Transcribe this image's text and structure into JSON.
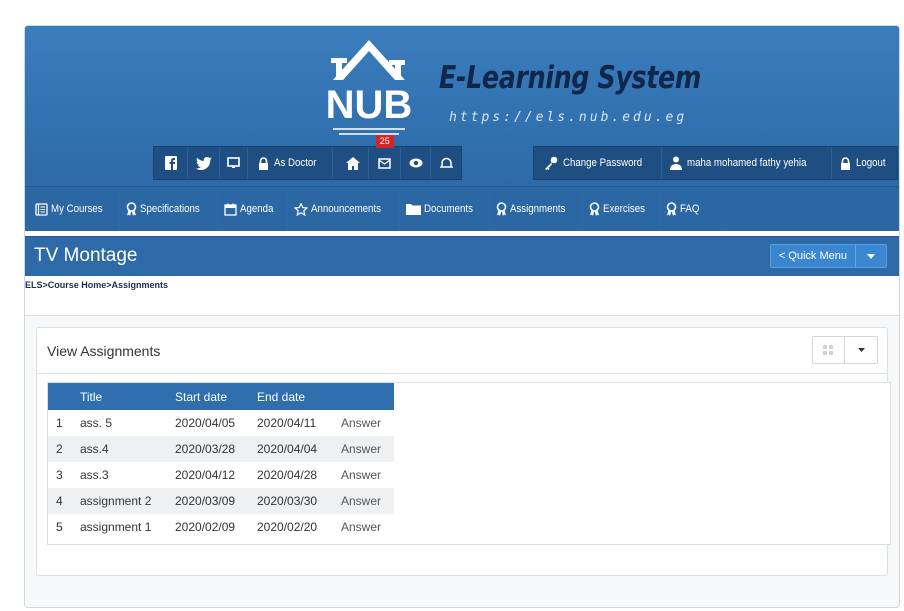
{
  "brand": {
    "logo_text": "NUB",
    "title": "E-Learning System",
    "url": "https://els.nub.edu.eg"
  },
  "toolbar_left": {
    "as_doctor": "As Doctor",
    "notification_count": "25"
  },
  "toolbar_right": {
    "change_password": "Change Password",
    "user_name": "maha mohamed fathy yehia",
    "logout": "Logout"
  },
  "nav": [
    {
      "label": "My Courses",
      "icon": "book-icon"
    },
    {
      "label": "Specifications",
      "icon": "ribbon-icon"
    },
    {
      "label": "Agenda",
      "icon": "calendar-icon"
    },
    {
      "label": "Announcements",
      "icon": "star-icon"
    },
    {
      "label": "Documents",
      "icon": "folder-icon"
    },
    {
      "label": "Assignments",
      "icon": "ribbon-icon"
    },
    {
      "label": "Exercises",
      "icon": "ribbon-icon"
    },
    {
      "label": "FAQ",
      "icon": "ribbon-icon"
    }
  ],
  "course": {
    "title": "TV Montage",
    "quick_menu": "< Quick Menu"
  },
  "breadcrumb": "ELS>Course Home>Assignments",
  "panel": {
    "title": "View Assignments"
  },
  "table": {
    "headers": [
      "",
      "Title",
      "Start date",
      "End date",
      ""
    ],
    "rows": [
      {
        "num": "1",
        "title": "ass. 5",
        "start": "2020/04/05",
        "end": "2020/04/11",
        "action": "Answer"
      },
      {
        "num": "2",
        "title": "ass.4",
        "start": "2020/03/28",
        "end": "2020/04/04",
        "action": "Answer"
      },
      {
        "num": "3",
        "title": "ass.3",
        "start": "2020/04/12",
        "end": "2020/04/28",
        "action": "Answer"
      },
      {
        "num": "4",
        "title": "assignment 2",
        "start": "2020/03/09",
        "end": "2020/03/30",
        "action": "Answer"
      },
      {
        "num": "5",
        "title": "assignment 1",
        "start": "2020/02/09",
        "end": "2020/02/20",
        "action": "Answer"
      }
    ]
  },
  "colors": {
    "header_blue": "#2f6fae",
    "toolbar_dark": "#1f4f82",
    "brand_text": "#10264a",
    "badge_red": "#d62424"
  }
}
